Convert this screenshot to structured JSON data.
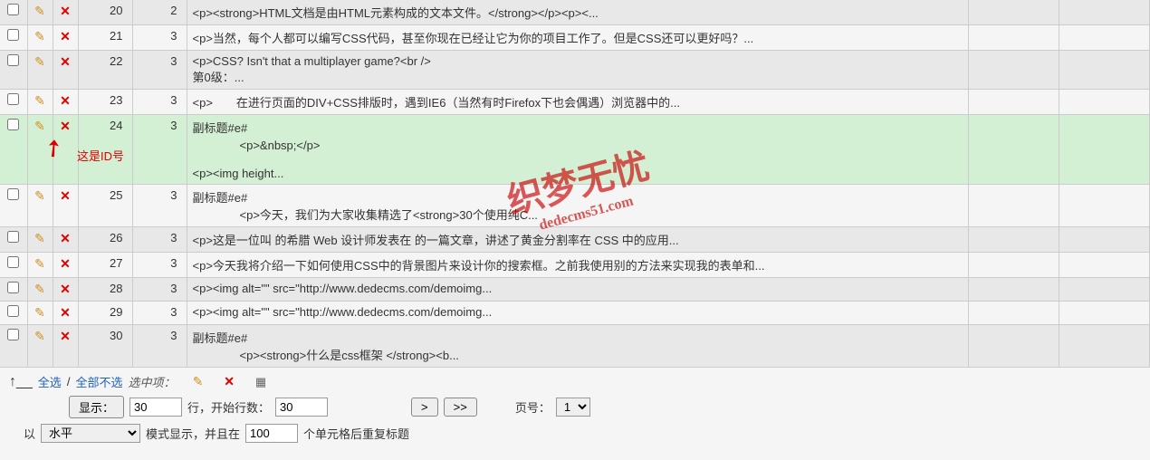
{
  "rows": [
    {
      "id": "20",
      "c3": "2",
      "body": "<p><strong>HTML文档是由HTML元素构成的文本文件。</strong></p><p><...",
      "cls": "odd"
    },
    {
      "id": "21",
      "c3": "3",
      "body": "<p>当然，每个人都可以编写CSS代码，甚至你现在已经让它为你的项目工作了。但是CSS还可以更好吗？...",
      "cls": "even"
    },
    {
      "id": "22",
      "c3": "3",
      "body": "<p>CSS? Isn't that a multiplayer game?<br />\n第0级：...",
      "cls": "odd"
    },
    {
      "id": "23",
      "c3": "3",
      "body": "<p>　　在进行页面的DIV+CSS排版时，遇到IE6（当然有时Firefox下也会偶遇）浏览器中的...",
      "cls": "even"
    },
    {
      "id": "24",
      "c3": "3",
      "body": "副标题#e#\n　　　　<p>&nbsp;</p>\n\n<p><img height...",
      "cls": "highlight"
    },
    {
      "id": "25",
      "c3": "3",
      "body": "副标题#e#\n　　　　<p>今天，我们为大家收集精选了<strong>30个使用纯C...",
      "cls": "even"
    },
    {
      "id": "26",
      "c3": "3",
      "body": "<p>这是一位叫  的希腊 Web 设计师发表在  的一篇文章，讲述了黄金分割率在 CSS 中的应用...",
      "cls": "odd"
    },
    {
      "id": "27",
      "c3": "3",
      "body": "<p>今天我将介绍一下如何使用CSS中的背景图片来设计你的搜索框。之前我使用别的方法来实现我的表单和...",
      "cls": "even"
    },
    {
      "id": "28",
      "c3": "3",
      "body": "<p><img alt=\"\" src=\"http://www.dedecms.com/demoimg...",
      "cls": "odd"
    },
    {
      "id": "29",
      "c3": "3",
      "body": "<p><img alt=\"\" src=\"http://www.dedecms.com/demoimg...",
      "cls": "even"
    },
    {
      "id": "30",
      "c3": "3",
      "body": "副标题#e#\n　　　　<p><strong>什么是css框架 </strong><b...",
      "cls": "odd"
    }
  ],
  "annotation": "这是ID号",
  "watermark": "织梦无忧",
  "watermark_sub": "dedecms51.com",
  "footer": {
    "select_all": "全选",
    "select_none": "全部不选",
    "selected_label": "选中项：",
    "show_btn": "显示：",
    "show_rows": "30",
    "rows_label": "行，开始行数：",
    "start_row": "30",
    "next": ">",
    "last": ">>",
    "page_label": "页号：",
    "page_val": "1",
    "prefix": "以",
    "mode": "水平",
    "mode_label": "模式显示，并且在",
    "cells": "100",
    "cells_label": "个单元格后重复标题"
  }
}
